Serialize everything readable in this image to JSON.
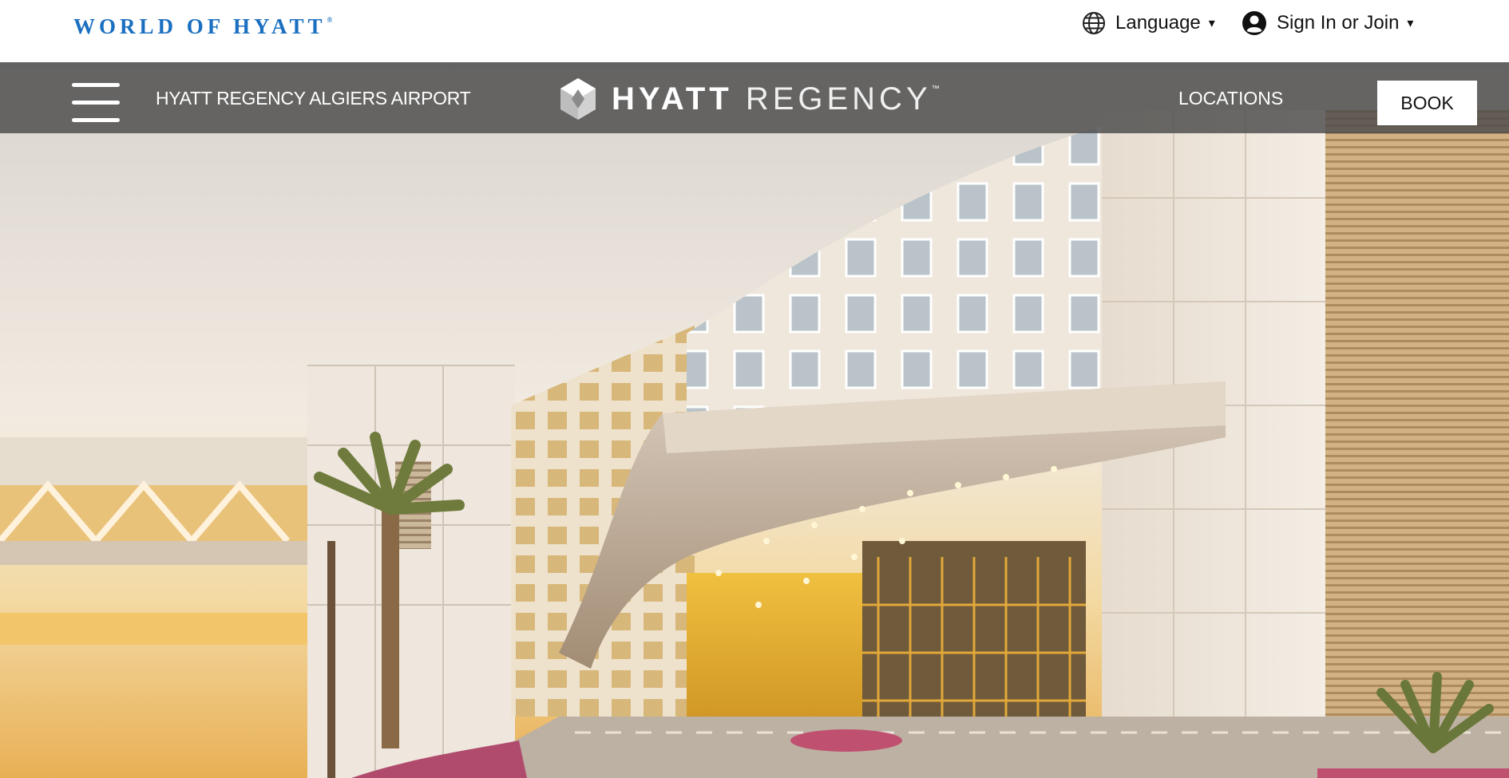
{
  "utility": {
    "brand": "WORLD OF HYATT",
    "brand_mark": "®",
    "language_label": "Language",
    "signin_label": "Sign In or Join",
    "caret": "▾"
  },
  "nav": {
    "hotel_name": "HYATT REGENCY ALGIERS AIRPORT",
    "logo_bold": "HYATT",
    "logo_light": "REGENCY",
    "logo_mark": "™",
    "locations_label": "LOCATIONS",
    "book_label": "BOOK"
  },
  "icons": {
    "menu": "hamburger-menu-icon",
    "language": "globe-icon",
    "account": "user-circle-icon",
    "logo": "hyatt-diamond-logo-icon"
  },
  "colors": {
    "brand_blue": "#1a6fc0",
    "nav_overlay": "#4b4b4b",
    "white": "#ffffff"
  }
}
